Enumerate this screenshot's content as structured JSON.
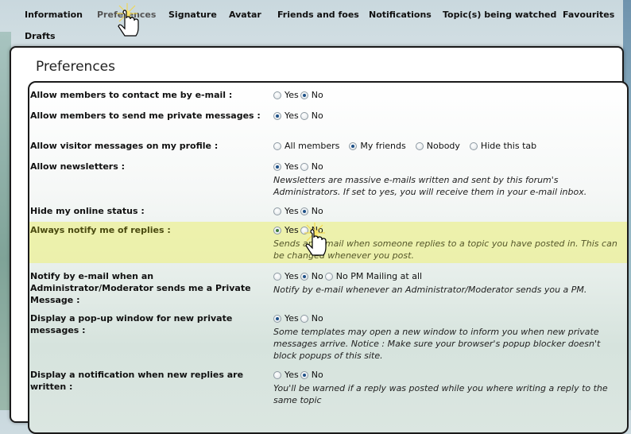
{
  "tabs": [
    {
      "label": "Information",
      "active": false
    },
    {
      "label": "Preferences",
      "active": true
    },
    {
      "label": "Signature",
      "active": false
    },
    {
      "label": "Avatar",
      "active": false
    },
    {
      "label": "Friends and foes",
      "active": false
    },
    {
      "label": "Notifications",
      "active": false
    },
    {
      "label": "Topic(s) being watched",
      "active": false
    },
    {
      "label": "Favourites",
      "active": false
    },
    {
      "label": "Drafts",
      "active": false
    }
  ],
  "panel": {
    "title": "Preferences",
    "rows": [
      {
        "label": "Allow members to contact me by e-mail :",
        "options": [
          "Yes",
          "No"
        ],
        "selected": "No"
      },
      {
        "label": "Allow members to send me private messages :",
        "options": [
          "Yes",
          "No"
        ],
        "selected": "Yes"
      },
      {
        "label": "Allow visitor messages on my profile :",
        "options": [
          "All members",
          "My friends",
          "Nobody",
          "Hide this tab"
        ],
        "selected": "My friends"
      },
      {
        "label": "Allow newsletters :",
        "options": [
          "Yes",
          "No"
        ],
        "selected": "Yes",
        "description": "Newsletters are massive e-mails written and sent by this forum's Administrators. If set to yes, you will receive them in your e-mail inbox."
      },
      {
        "label": "Hide my online status :",
        "options": [
          "Yes",
          "No"
        ],
        "selected": "No"
      },
      {
        "label": "Always notify me of replies :",
        "options": [
          "Yes",
          "No"
        ],
        "selected": "Yes",
        "highlighted": true,
        "description": "Sends an e-mail when someone replies to a topic you have posted in. This can be changed whenever you post."
      },
      {
        "label": "Notify by e-mail when an Administrator/Moderator sends me a Private Message :",
        "options": [
          "Yes",
          "No",
          "No PM Mailing at all"
        ],
        "selected": "No",
        "description": "Notify by e-mail whenever an Administrator/Moderator sends you a PM."
      },
      {
        "label": "Display a pop-up window for new private messages :",
        "options": [
          "Yes",
          "No"
        ],
        "selected": "Yes",
        "description": "Some templates may open a new window to inform you when new private messages arrive. Notice : Make sure your browser's popup blocker doesn't block popups of this site."
      },
      {
        "label": "Display a notification when new replies are written :",
        "options": [
          "Yes",
          "No"
        ],
        "selected": "No",
        "description": "You'll be warned if a reply was posted while you where writing a reply to the same topic"
      }
    ]
  },
  "colors": {
    "highlight": "#ecf096",
    "radio_selected": "#1c4f86"
  }
}
